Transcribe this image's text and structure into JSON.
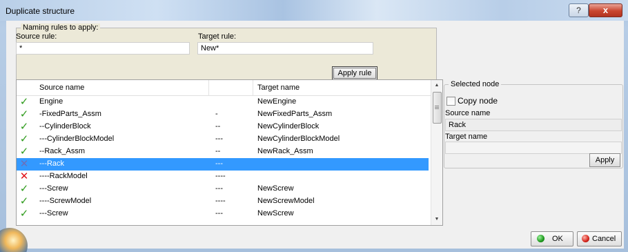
{
  "window": {
    "title": "Duplicate structure",
    "help_glyph": "?",
    "close_glyph": "x"
  },
  "naming": {
    "group_label": "Naming rules to apply:",
    "source_label": "Source rule:",
    "source_value": "*",
    "target_label": "Target rule:",
    "target_value": "New*",
    "apply_rule_label": "Apply rule"
  },
  "table": {
    "headers": {
      "source": "Source name",
      "target": "Target name"
    },
    "rows": [
      {
        "status": "ok",
        "status_glyph": "✓",
        "source": "Engine",
        "mid": "",
        "target": "NewEngine"
      },
      {
        "status": "ok",
        "status_glyph": "✓",
        "source": "-FixedParts_Assm",
        "mid": "-",
        "target": "NewFixedParts_Assm"
      },
      {
        "status": "ok",
        "status_glyph": "✓",
        "source": "--CylinderBlock",
        "mid": "--",
        "target": "NewCylinderBlock"
      },
      {
        "status": "ok",
        "status_glyph": "✓",
        "source": "---CylinderBlockModel",
        "mid": "---",
        "target": "NewCylinderBlockModel"
      },
      {
        "status": "ok",
        "status_glyph": "✓",
        "source": "--Rack_Assm",
        "mid": "--",
        "target": "NewRack_Assm"
      },
      {
        "status": "selected",
        "status_glyph": "✕",
        "source": "---Rack",
        "mid": "---",
        "target": ""
      },
      {
        "status": "error",
        "status_glyph": "✕",
        "source": "----RackModel",
        "mid": "----",
        "target": ""
      },
      {
        "status": "ok",
        "status_glyph": "✓",
        "source": "---Screw",
        "mid": "---",
        "target": "NewScrew"
      },
      {
        "status": "ok",
        "status_glyph": "✓",
        "source": "----ScrewModel",
        "mid": "----",
        "target": "NewScrewModel"
      },
      {
        "status": "ok",
        "status_glyph": "✓",
        "source": "---Screw",
        "mid": "---",
        "target": "NewScrew"
      }
    ]
  },
  "selected_node": {
    "group_label": "Selected node",
    "copy_node_label": "Copy node",
    "source_name_label": "Source name",
    "source_name_value": "Rack",
    "target_name_label": "Target name",
    "target_name_value": "",
    "apply_label": "Apply"
  },
  "footer": {
    "ok_label": "OK",
    "cancel_label": "Cancel"
  },
  "colors": {
    "selection": "#3399ff",
    "ok_check": "#2e9b1c",
    "error_x": "#e0131a",
    "ok_dot": "#1e9a1e",
    "cancel_dot": "#d4241c"
  }
}
